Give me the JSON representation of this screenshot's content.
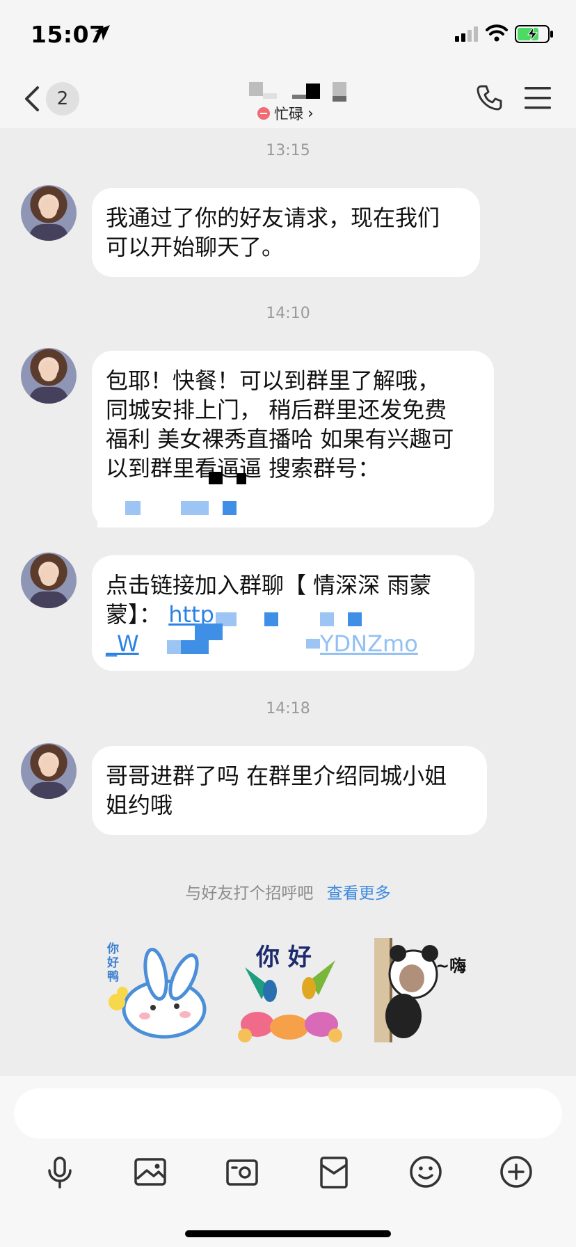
{
  "status_bar": {
    "time": "15:07"
  },
  "nav": {
    "unread_count": "2",
    "presence": "忙碌",
    "presence_chevron": "›"
  },
  "messages": [
    {
      "timestamp": "13:15",
      "lines": [
        "我通过了你的好友请求，现在我们",
        "可以开始聊天了。"
      ]
    },
    {
      "timestamp": "14:10",
      "lines": [
        "包耶！快餐！可以到群里了解哦，",
        "同城安排上门， 稍后群里还发免费",
        "福利 美女裸秀直播哈 如果有兴趣可",
        "以到群里看逼逼  搜索群号："
      ]
    },
    {
      "timestamp": "",
      "lines": [
        "点击链接加入群聊【 情深深 雨蒙",
        "蒙】："
      ],
      "link_start": "http",
      "link_line2_start": "_W",
      "link_end": "YDNZmo"
    },
    {
      "timestamp": "14:18",
      "lines": [
        "哥哥进群了吗 在群里介绍同城小姐",
        "姐约哦"
      ]
    }
  ],
  "greeting": {
    "text": "与好友打个招呼吧",
    "more": "查看更多"
  },
  "stickers": [
    {
      "name": "rabbit-sticker",
      "text": "你好鸭"
    },
    {
      "name": "hummingbird-sticker",
      "text": "你 好"
    },
    {
      "name": "panda-sticker",
      "text": "~嗨"
    }
  ],
  "toolbar": [
    "microphone-icon",
    "image-icon",
    "camera-icon",
    "red-packet-icon",
    "emoji-icon",
    "plus-icon"
  ]
}
